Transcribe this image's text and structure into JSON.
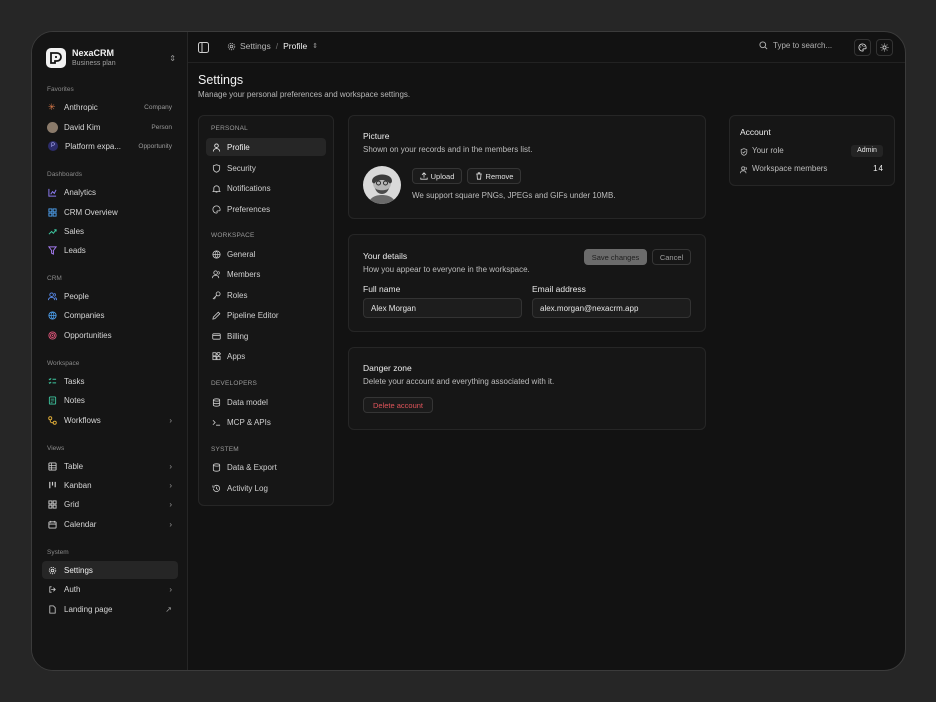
{
  "brand": {
    "name": "NexaCRM",
    "plan": "Business plan"
  },
  "sidebar": {
    "favorites_label": "Favorites",
    "favorites": [
      {
        "label": "Anthropic",
        "tag": "Company",
        "icon": "anthropic-icon",
        "color": "#d97a4a"
      },
      {
        "label": "David Kim",
        "tag": "Person",
        "icon": "avatar-icon"
      },
      {
        "label": "Platform expa...",
        "tag": "Opportunity",
        "icon": "p-badge-icon",
        "color": "#3b3b8f"
      }
    ],
    "dashboards_label": "Dashboards",
    "dashboards": [
      {
        "label": "Analytics",
        "icon": "chart-icon",
        "color": "#8b7bf0"
      },
      {
        "label": "CRM Overview",
        "icon": "grid-icon",
        "color": "#4ea1f0"
      },
      {
        "label": "Sales",
        "icon": "trend-icon",
        "color": "#3ec7a0"
      },
      {
        "label": "Leads",
        "icon": "funnel-icon",
        "color": "#a47bf0"
      }
    ],
    "crm_label": "CRM",
    "crm": [
      {
        "label": "People",
        "icon": "people-icon",
        "color": "#5a8df0"
      },
      {
        "label": "Companies",
        "icon": "building-icon",
        "color": "#4ea1f0"
      },
      {
        "label": "Opportunities",
        "icon": "target-icon",
        "color": "#e0567a"
      }
    ],
    "workspace_label": "Workspace",
    "workspace": [
      {
        "label": "Tasks",
        "icon": "tasks-icon",
        "color": "#3ec7a0"
      },
      {
        "label": "Notes",
        "icon": "notes-icon",
        "color": "#3ec7a0"
      },
      {
        "label": "Workflows",
        "icon": "workflow-icon",
        "color": "#e8b33a"
      }
    ],
    "views_label": "Views",
    "views": [
      {
        "label": "Table",
        "icon": "table-icon"
      },
      {
        "label": "Kanban",
        "icon": "kanban-icon"
      },
      {
        "label": "Grid",
        "icon": "grid-view-icon"
      },
      {
        "label": "Calendar",
        "icon": "calendar-icon"
      }
    ],
    "system_label": "System",
    "system": [
      {
        "label": "Settings",
        "icon": "gear-icon"
      },
      {
        "label": "Auth",
        "icon": "auth-icon"
      },
      {
        "label": "Landing page",
        "icon": "page-icon"
      }
    ]
  },
  "topbar": {
    "crumb_root": "Settings",
    "crumb_sep": "/",
    "crumb_current": "Profile",
    "search_placeholder": "Type to search..."
  },
  "header": {
    "title": "Settings",
    "subtitle": "Manage your personal preferences and workspace settings."
  },
  "settings_nav": {
    "personal_label": "PERSONAL",
    "personal": [
      "Profile",
      "Security",
      "Notifications",
      "Preferences"
    ],
    "workspace_label": "WORKSPACE",
    "workspace": [
      "General",
      "Members",
      "Roles",
      "Pipeline Editor",
      "Billing",
      "Apps"
    ],
    "developers_label": "DEVELOPERS",
    "developers": [
      "Data model",
      "MCP & APIs"
    ],
    "system_label": "SYSTEM",
    "system": [
      "Data & Export",
      "Activity Log"
    ]
  },
  "picture": {
    "title": "Picture",
    "subtitle": "Shown on your records and in the members list.",
    "upload": "Upload",
    "remove": "Remove",
    "hint": "We support square PNGs, JPEGs and GIFs under 10MB."
  },
  "details": {
    "title": "Your details",
    "subtitle": "How you appear to everyone in the workspace.",
    "save": "Save changes",
    "cancel": "Cancel",
    "full_name_label": "Full name",
    "full_name": "Alex Morgan",
    "email_label": "Email address",
    "email": "alex.morgan@nexacrm.app"
  },
  "danger": {
    "title": "Danger zone",
    "subtitle": "Delete your account and everything associated with it.",
    "delete": "Delete account"
  },
  "account": {
    "title": "Account",
    "role_label": "Your role",
    "role": "Admin",
    "members_label": "Workspace members",
    "members": "14"
  },
  "colors": {
    "danger": "#e0545a",
    "accent": "#f2f2f2"
  }
}
